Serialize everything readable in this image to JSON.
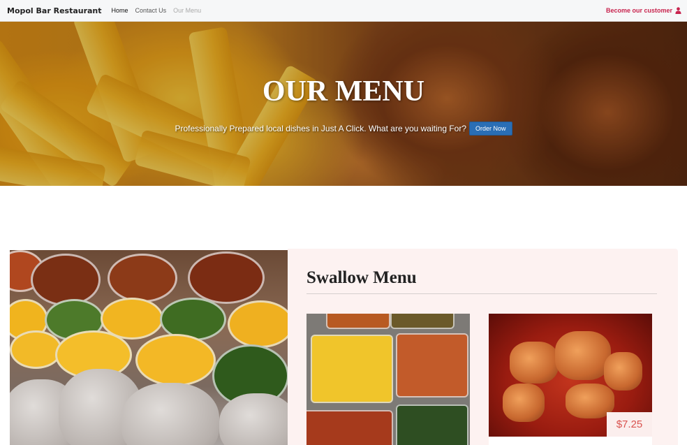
{
  "navbar": {
    "brand": "Mopol Bar Restaurant",
    "links": [
      {
        "label": "Home"
      },
      {
        "label": "Contact Us"
      },
      {
        "label": "Our Menu"
      }
    ],
    "cta_label": "Become our customer",
    "cta_icon": "user-icon",
    "cta_color": "#c8244e"
  },
  "hero": {
    "title": "OUR MENU",
    "subtitle": "Professionally Prepared local dishes in Just A Click. What are you waiting For?",
    "button_label": "Order Now",
    "button_color": "#2a6eb5"
  },
  "menu_section": {
    "heading": "Swallow Menu",
    "items": [
      {
        "image": "swallow-soups-image"
      },
      {
        "image": "pepper-soup-image",
        "price": "$7.25"
      }
    ],
    "price_color": "#d9534f",
    "card_background": "#fdf2f1"
  }
}
